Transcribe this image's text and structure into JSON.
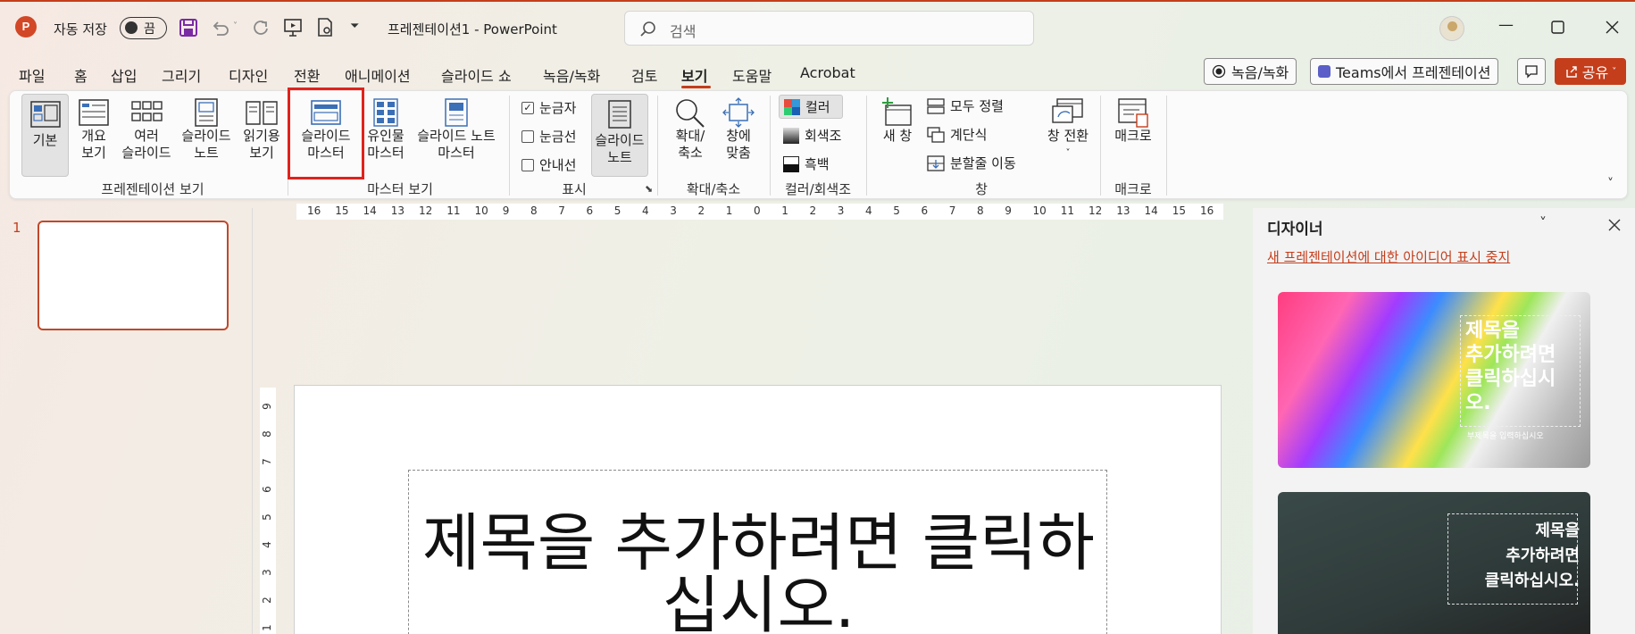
{
  "titlebar": {
    "autosave_label": "자동 저장",
    "autosave_state": "끔",
    "doc_title": "프레젠테이션1  -  PowerPoint",
    "search_placeholder": "검색"
  },
  "tabs": [
    "파일",
    "홈",
    "삽입",
    "그리기",
    "디자인",
    "전환",
    "애니메이션",
    "슬라이드 쇼",
    "녹음/녹화",
    "검토",
    "보기",
    "도움말",
    "Acrobat"
  ],
  "active_tab": "보기",
  "right_buttons": {
    "record": "녹음/녹화",
    "teams": "Teams에서 프레젠테이션",
    "share": "공유"
  },
  "ribbon": {
    "presentation_views": {
      "name": "프레젠테이션 보기",
      "items": [
        [
          "기본",
          ""
        ],
        [
          "개요",
          "보기"
        ],
        [
          "여러",
          "슬라이드"
        ],
        [
          "슬라이드",
          "노트"
        ],
        [
          "읽기용",
          "보기"
        ]
      ]
    },
    "master_views": {
      "name": "마스터 보기",
      "items": [
        [
          "슬라이드",
          "마스터"
        ],
        [
          "유인물",
          "마스터"
        ],
        [
          "슬라이드 노트",
          "마스터"
        ]
      ]
    },
    "show": {
      "name": "표시",
      "checks": [
        "눈금자",
        "눈금선",
        "안내선"
      ],
      "ruler_checked": true,
      "notes": [
        "슬라이드",
        "노트"
      ]
    },
    "zoom": {
      "name": "확대/축소",
      "items": [
        [
          "확대/",
          "축소"
        ],
        [
          "창에",
          "맞춤"
        ]
      ]
    },
    "color": {
      "name": "컬러/회색조",
      "items": [
        "컬러",
        "회색조",
        "흑백"
      ]
    },
    "window": {
      "name": "창",
      "new": "새 창",
      "items": [
        "모두 정렬",
        "계단식",
        "분할줄 이동"
      ],
      "switch": "창 전환"
    },
    "macros": {
      "name": "매크로",
      "item": "매크로"
    }
  },
  "hruler_labels": [
    "16",
    "15",
    "14",
    "13",
    "12",
    "11",
    "10",
    "9",
    "8",
    "7",
    "6",
    "5",
    "4",
    "3",
    "2",
    "1",
    "0",
    "1",
    "2",
    "3",
    "4",
    "5",
    "6",
    "7",
    "8",
    "9",
    "10",
    "11",
    "12",
    "13",
    "14",
    "15",
    "16"
  ],
  "vruler_labels": [
    "9",
    "8",
    "7",
    "6",
    "5",
    "4",
    "3",
    "2",
    "1"
  ],
  "thumbnail": {
    "number": "1"
  },
  "slide": {
    "title": "제목을 추가하려면 클릭하십시오."
  },
  "designer": {
    "title": "디자이너",
    "link": "새 프레젠테이션에 대한 아이디어 표시 중지",
    "card1_title": "제목을\n추가하려면\n클릭하십시\n오.",
    "card1_sub": "부제목을 입력하십시오",
    "card2_title": "제목을\n추가하려면\n클릭하십시오."
  },
  "colors": {
    "accent": "#c43e1c",
    "highlight": "#e0221c"
  }
}
